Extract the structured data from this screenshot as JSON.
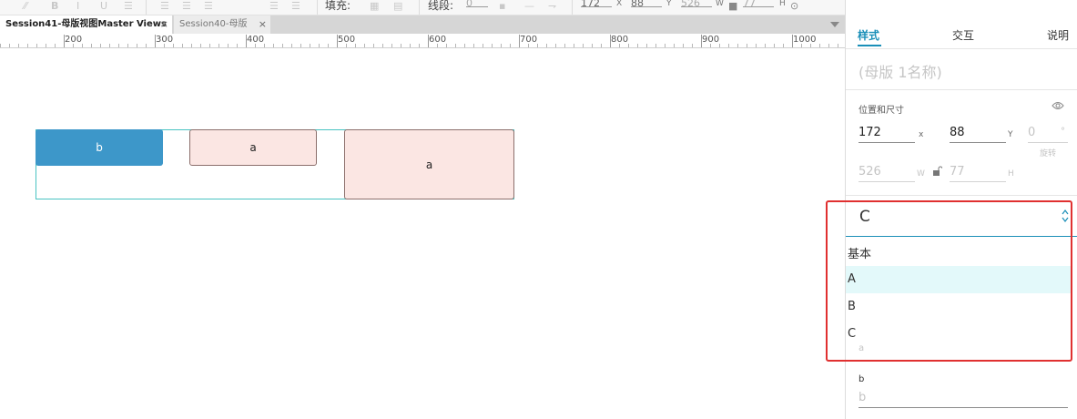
{
  "toolbar": {
    "fill_label": "填充:",
    "line_label": "线段:",
    "x_value": "172",
    "x_label": "X",
    "y_value": "88",
    "y_label": "Y",
    "w_value": "526",
    "w_label": "W",
    "h_value": "77",
    "h_label": "H"
  },
  "tabs": [
    {
      "label": "Session41-母版视图Master Views",
      "active": true
    },
    {
      "label": "Session40-母版",
      "active": false
    }
  ],
  "ruler": {
    "labels": [
      "200",
      "300",
      "400",
      "500",
      "600",
      "700",
      "800",
      "900",
      "1000"
    ]
  },
  "canvas": {
    "widgets": [
      {
        "label": "b"
      },
      {
        "label": "a"
      },
      {
        "label": "a"
      }
    ]
  },
  "panel": {
    "tabs": [
      "样式",
      "交互",
      "说明"
    ],
    "active_tab": "样式",
    "master_name_placeholder": "(母版 1名称)",
    "position_size_label": "位置和尺寸",
    "x": {
      "value": "172",
      "label": "x"
    },
    "y": {
      "value": "88",
      "label": "Y"
    },
    "rotation": {
      "value": "0",
      "unit": "°",
      "label": "旋转"
    },
    "w": {
      "value": "526",
      "label": "W"
    },
    "h": {
      "value": "77",
      "label": "H"
    },
    "state_dropdown": {
      "selected": "C",
      "group": "基本",
      "options": [
        "A",
        "B",
        "C"
      ],
      "hovered": "A"
    },
    "override_a_value": "a",
    "override_b_label": "b",
    "override_b_placeholder": "b"
  },
  "colors": {
    "accent": "#1a8fb8",
    "widget_b_fill": "#3d97c9",
    "widget_a_fill": "#fbe6e3",
    "master_outline": "#49c3c2",
    "highlight_box": "#e03030",
    "option_hover": "#e3f9fa"
  }
}
